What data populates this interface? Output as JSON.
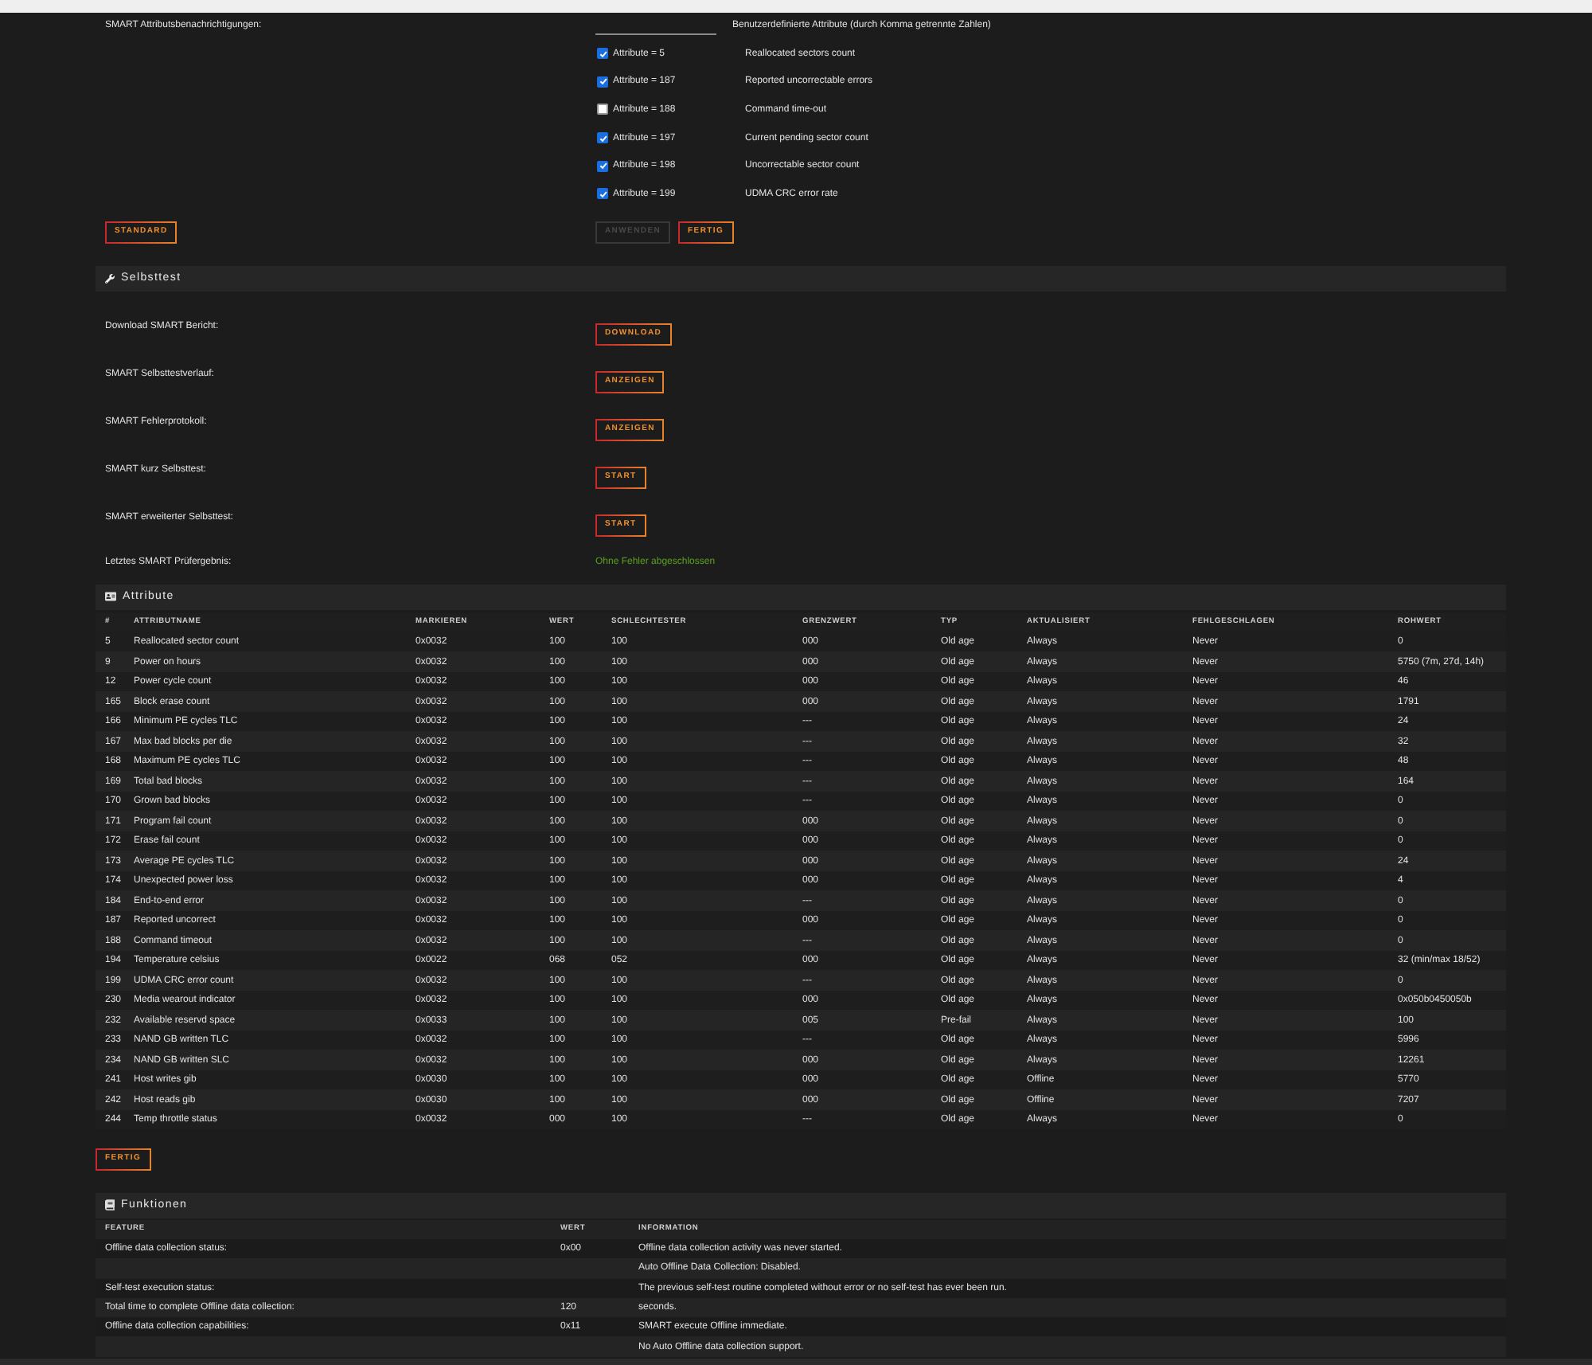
{
  "notifications": {
    "label": "SMART Attributsbenachrichtigungen:",
    "custom_attributes": {
      "label": "Benutzerdefinierte Attribute (durch Komma getrennte Zahlen)"
    },
    "attributes": [
      {
        "label": "Attribute = 5",
        "description": "Reallocated sectors count",
        "checked": true
      },
      {
        "label": "Attribute = 187",
        "description": "Reported uncorrectable errors",
        "checked": true
      },
      {
        "label": "Attribute = 188",
        "description": "Command time-out",
        "checked": false
      },
      {
        "label": "Attribute = 197",
        "description": "Current pending sector count",
        "checked": true
      },
      {
        "label": "Attribute = 198",
        "description": "Uncorrectable sector count",
        "checked": true
      },
      {
        "label": "Attribute = 199",
        "description": "UDMA CRC error rate",
        "checked": true
      }
    ],
    "default_button": {
      "label": "STANDARD",
      "disabled": false
    },
    "buttons": [
      {
        "label": "ANWENDEN",
        "disabled": true
      },
      {
        "label": "FERTIG",
        "disabled": false
      }
    ]
  },
  "selftest": {
    "title": "Selbsttest",
    "rows": [
      {
        "kind": "button",
        "label": "Download SMART Bericht:",
        "button": "DOWNLOAD"
      },
      {
        "kind": "button",
        "label": "SMART Selbsttestverlauf:",
        "button": "ANZEIGEN"
      },
      {
        "kind": "button",
        "label": "SMART Fehlerprotokoll:",
        "button": "ANZEIGEN"
      },
      {
        "kind": "button",
        "label": "SMART kurz Selbsttest:",
        "button": "START"
      },
      {
        "kind": "button",
        "label": "SMART erweiterter Selbsttest:",
        "button": "START"
      },
      {
        "kind": "status",
        "label": "Letztes SMART Prüfergebnis:",
        "value": "Ohne Fehler abgeschlossen"
      }
    ]
  },
  "attributes": {
    "title": "Attribute",
    "columns": [
      "#",
      "ATTRIBUTNAME",
      "MARKIEREN",
      "WERT",
      "SCHLECHTESTER",
      "GRENZWERT",
      "TYP",
      "AKTUALISIERT",
      "FEHLGESCHLAGEN",
      "ROHWERT"
    ],
    "rows": [
      [
        "5",
        "Reallocated sector count",
        "0x0032",
        "100",
        "100",
        "000",
        "Old age",
        "Always",
        "Never",
        "0"
      ],
      [
        "9",
        "Power on hours",
        "0x0032",
        "100",
        "100",
        "000",
        "Old age",
        "Always",
        "Never",
        "5750 (7m, 27d, 14h)"
      ],
      [
        "12",
        "Power cycle count",
        "0x0032",
        "100",
        "100",
        "000",
        "Old age",
        "Always",
        "Never",
        "46"
      ],
      [
        "165",
        "Block erase count",
        "0x0032",
        "100",
        "100",
        "000",
        "Old age",
        "Always",
        "Never",
        "1791"
      ],
      [
        "166",
        "Minimum PE cycles TLC",
        "0x0032",
        "100",
        "100",
        "---",
        "Old age",
        "Always",
        "Never",
        "24"
      ],
      [
        "167",
        "Max bad blocks per die",
        "0x0032",
        "100",
        "100",
        "---",
        "Old age",
        "Always",
        "Never",
        "32"
      ],
      [
        "168",
        "Maximum PE cycles TLC",
        "0x0032",
        "100",
        "100",
        "---",
        "Old age",
        "Always",
        "Never",
        "48"
      ],
      [
        "169",
        "Total bad blocks",
        "0x0032",
        "100",
        "100",
        "---",
        "Old age",
        "Always",
        "Never",
        "164"
      ],
      [
        "170",
        "Grown bad blocks",
        "0x0032",
        "100",
        "100",
        "---",
        "Old age",
        "Always",
        "Never",
        "0"
      ],
      [
        "171",
        "Program fail count",
        "0x0032",
        "100",
        "100",
        "000",
        "Old age",
        "Always",
        "Never",
        "0"
      ],
      [
        "172",
        "Erase fail count",
        "0x0032",
        "100",
        "100",
        "000",
        "Old age",
        "Always",
        "Never",
        "0"
      ],
      [
        "173",
        "Average PE cycles TLC",
        "0x0032",
        "100",
        "100",
        "000",
        "Old age",
        "Always",
        "Never",
        "24"
      ],
      [
        "174",
        "Unexpected power loss",
        "0x0032",
        "100",
        "100",
        "000",
        "Old age",
        "Always",
        "Never",
        "4"
      ],
      [
        "184",
        "End-to-end error",
        "0x0032",
        "100",
        "100",
        "---",
        "Old age",
        "Always",
        "Never",
        "0"
      ],
      [
        "187",
        "Reported uncorrect",
        "0x0032",
        "100",
        "100",
        "000",
        "Old age",
        "Always",
        "Never",
        "0"
      ],
      [
        "188",
        "Command timeout",
        "0x0032",
        "100",
        "100",
        "---",
        "Old age",
        "Always",
        "Never",
        "0"
      ],
      [
        "194",
        "Temperature celsius",
        "0x0022",
        "068",
        "052",
        "000",
        "Old age",
        "Always",
        "Never",
        "32 (min/max 18/52)"
      ],
      [
        "199",
        "UDMA CRC error count",
        "0x0032",
        "100",
        "100",
        "---",
        "Old age",
        "Always",
        "Never",
        "0"
      ],
      [
        "230",
        "Media wearout indicator",
        "0x0032",
        "100",
        "100",
        "000",
        "Old age",
        "Always",
        "Never",
        "0x050b0450050b"
      ],
      [
        "232",
        "Available reservd space",
        "0x0033",
        "100",
        "100",
        "005",
        "Pre-fail",
        "Always",
        "Never",
        "100"
      ],
      [
        "233",
        "NAND GB written TLC",
        "0x0032",
        "100",
        "100",
        "---",
        "Old age",
        "Always",
        "Never",
        "5996"
      ],
      [
        "234",
        "NAND GB written SLC",
        "0x0032",
        "100",
        "100",
        "000",
        "Old age",
        "Always",
        "Never",
        "12261"
      ],
      [
        "241",
        "Host writes gib",
        "0x0030",
        "100",
        "100",
        "000",
        "Old age",
        "Offline",
        "Never",
        "5770"
      ],
      [
        "242",
        "Host reads gib",
        "0x0030",
        "100",
        "100",
        "000",
        "Old age",
        "Offline",
        "Never",
        "7207"
      ],
      [
        "244",
        "Temp throttle status",
        "0x0032",
        "000",
        "100",
        "---",
        "Old age",
        "Always",
        "Never",
        "0"
      ]
    ],
    "button": {
      "label": "FERTIG",
      "disabled": false
    }
  },
  "features": {
    "title": "Funktionen",
    "columns": [
      "FEATURE",
      "WERT",
      "INFORMATION"
    ],
    "rows": [
      {
        "feature": "Offline data collection status:",
        "value": "0x00",
        "information": "Offline data collection activity was never started."
      },
      {
        "information": "Auto Offline Data Collection: Disabled."
      },
      {
        "feature": "Self-test execution status:",
        "information": "The previous self-test routine completed without error or no self-test has ever been run."
      },
      {
        "feature": "Total time to complete Offline data collection:",
        "value": "120",
        "information": "seconds."
      },
      {
        "feature": "Offline data collection capabilities:",
        "value": "0x11",
        "information": "SMART execute Offline immediate."
      },
      {
        "information": "No Auto Offline data collection support."
      }
    ]
  }
}
